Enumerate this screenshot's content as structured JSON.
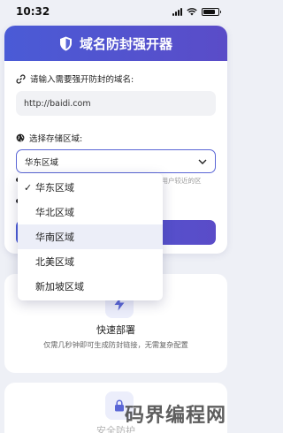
{
  "status_bar": {
    "time": "10:32"
  },
  "header": {
    "title": "域名防封强开器"
  },
  "form": {
    "url_label": "请输入需要强开防封的域名:",
    "url_value": "http://baidi.com",
    "region_label": "选择存储区域:",
    "region_selected": "华东区域",
    "hint_text": "离用户较近的区"
  },
  "dropdown": {
    "options": [
      {
        "label": "华东区域",
        "checked": true
      },
      {
        "label": "华北区域",
        "checked": false
      },
      {
        "label": "华南区域",
        "checked": false
      },
      {
        "label": "北美区域",
        "checked": false
      },
      {
        "label": "新加坡区域",
        "checked": false
      }
    ]
  },
  "features": [
    {
      "title": "快速部署",
      "desc": "仅需几秒钟即可生成防封链接，无需复杂配置",
      "icon": "lightning-icon"
    },
    {
      "title": "安全防护",
      "desc": "",
      "icon": "lock-icon"
    }
  ],
  "watermark": "码界编程网",
  "colors": {
    "accent": "#4a5bd6",
    "accent2": "#5a4cc8",
    "background": "#eef0f6"
  }
}
